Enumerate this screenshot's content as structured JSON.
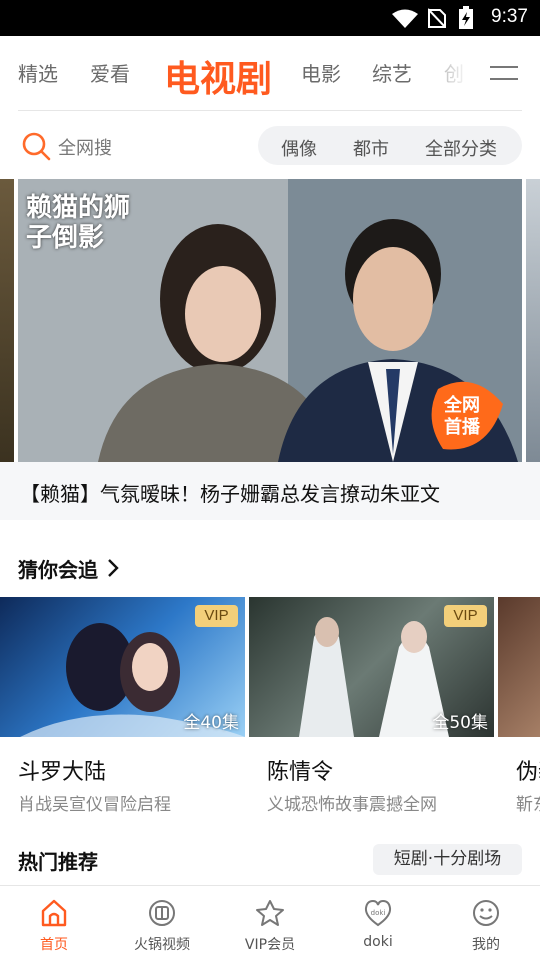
{
  "status_bar": {
    "time": "9:37"
  },
  "top_tabs": [
    {
      "label": "精选"
    },
    {
      "label": "爱看"
    },
    {
      "label": "电视剧",
      "active": true
    },
    {
      "label": "电影"
    },
    {
      "label": "综艺"
    },
    {
      "label": "创"
    }
  ],
  "search": {
    "placeholder": "全网搜"
  },
  "categories": [
    "偶像",
    "都市",
    "全部分类"
  ],
  "banner": {
    "logo_text": "赖猫的狮子倒影",
    "live_badge": "全网\n首播",
    "caption": "【赖猫】气氛暧昧！杨子姗霸总发言撩动朱亚文"
  },
  "guess_section": {
    "title": "猜你会追",
    "cards": [
      {
        "title": "斗罗大陆",
        "subtitle": "肖战吴宣仪冒险启程",
        "badge": "VIP",
        "episodes": "全40集"
      },
      {
        "title": "陈情令",
        "subtitle": "义城恐怖故事震撼全网",
        "badge": "VIP",
        "episodes": "全50集"
      },
      {
        "title": "伪装",
        "subtitle": "靳东"
      }
    ]
  },
  "hot_section": {
    "title": "热门推荐",
    "tag": "短剧·十分剧场"
  },
  "bottom_nav": [
    {
      "label": "首页",
      "icon": "home-icon",
      "active": true
    },
    {
      "label": "火锅视频",
      "icon": "film-reel-icon"
    },
    {
      "label": "VIP会员",
      "icon": "vip-crown-icon"
    },
    {
      "label": "doki",
      "icon": "doki-heart-icon"
    },
    {
      "label": "我的",
      "icon": "profile-face-icon"
    }
  ],
  "colors": {
    "accent": "#ff5a1f",
    "vip_badge": "#f3cf7a"
  }
}
